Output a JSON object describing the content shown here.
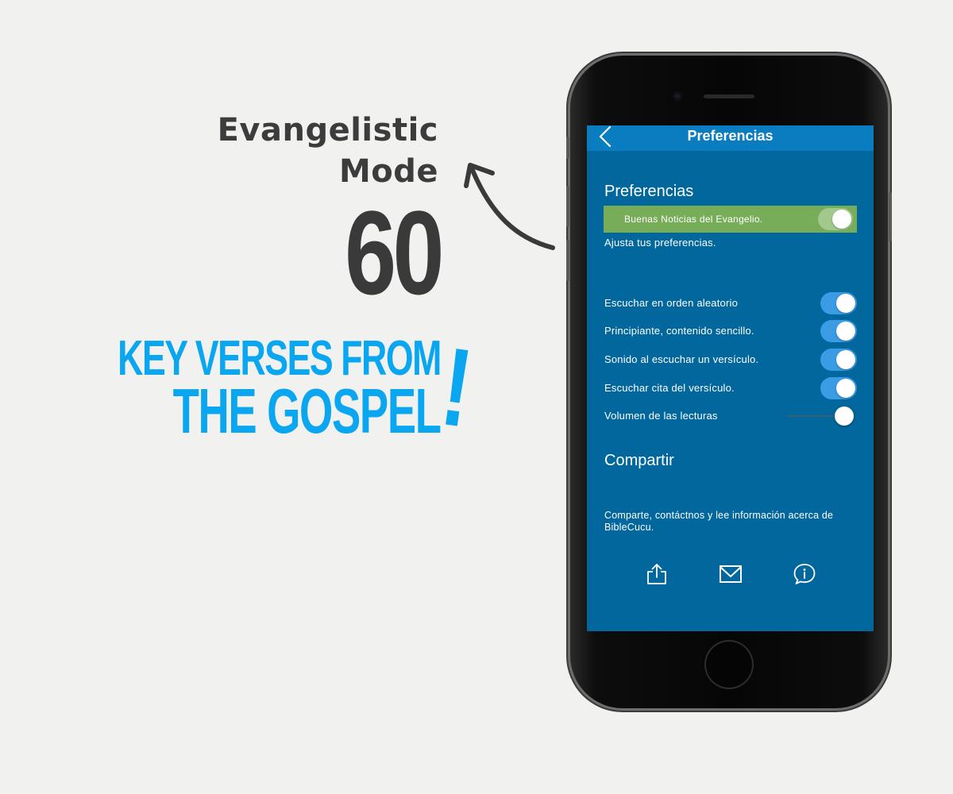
{
  "promo": {
    "title_line1": "Evangelistic",
    "title_line2": "Mode",
    "number": "60",
    "tagline_line1": "KEY VERSES FROM",
    "tagline_line2": "THE GOSPEL",
    "exclamation": "!"
  },
  "colors": {
    "screen_bg": "#01679c",
    "nav_bg": "#0a7cc0",
    "highlight_row": "#77ad58",
    "toggle_on": "#3b9ce6",
    "tagline": "#0aa6f0",
    "promo_text": "#3c3c3c"
  },
  "app": {
    "nav": {
      "back_icon": "chevron-left-icon",
      "title": "Preferencias"
    },
    "preferences": {
      "header": "Preferencias",
      "highlight_toggle": {
        "label": "Buenas Noticias del Evangelio.",
        "on": true
      },
      "subtitle": "Ajusta tus preferencias.",
      "settings": [
        {
          "label": "Escuchar en orden aleatorio",
          "on": true
        },
        {
          "label": "Principiante, contenido sencillo.",
          "on": true
        },
        {
          "label": "Sonido al escuchar un versículo.",
          "on": true
        },
        {
          "label": "Escuchar cita del versículo.",
          "on": true
        }
      ],
      "volume": {
        "label": "Volumen de las lecturas",
        "level": 1.0
      }
    },
    "share": {
      "header": "Compartir",
      "description": "Comparte, contáctnos y lee información acerca de BibleCucu.",
      "icons": [
        "share-icon",
        "mail-icon",
        "info-chat-icon"
      ]
    }
  }
}
